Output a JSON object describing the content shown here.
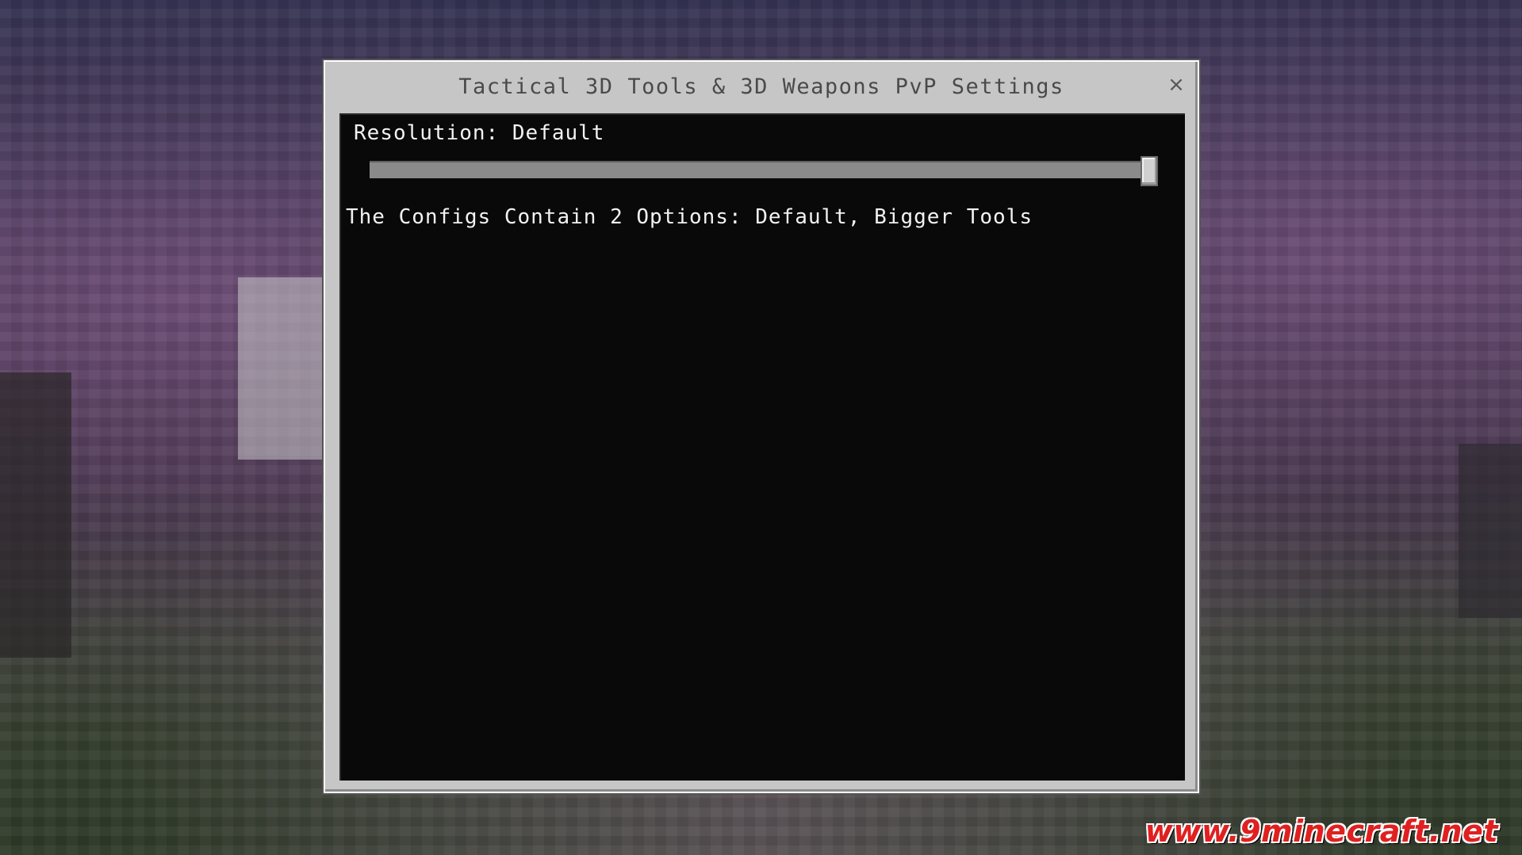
{
  "dialog": {
    "title": "Tactical 3D Tools & 3D Weapons PvP Settings",
    "close_icon": "close-icon",
    "close_glyph": "×"
  },
  "settings": {
    "resolution_label": "Resolution",
    "resolution_value": "Default",
    "slider_position": 1.0,
    "info_text": "The Configs Contain 2 Options: Default, Bigger Tools"
  },
  "watermark": "www.9minecraft.net"
}
